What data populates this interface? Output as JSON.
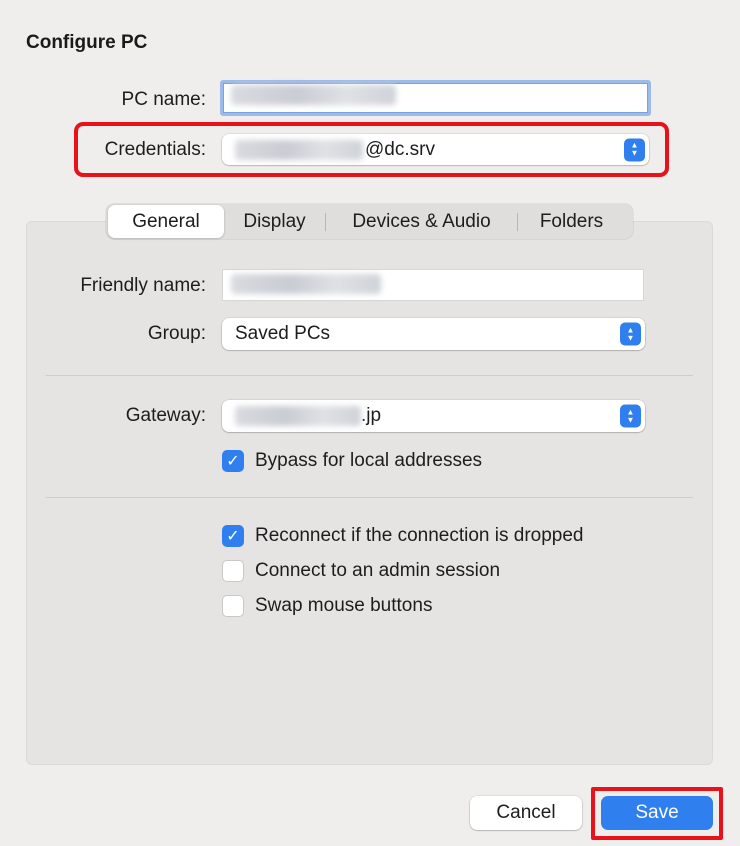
{
  "dialog": {
    "title": "Configure PC"
  },
  "pc_name": {
    "label": "PC name:",
    "value": ""
  },
  "credentials": {
    "label": "Credentials:",
    "value_suffix": "@dc.srv"
  },
  "tabs": [
    {
      "label": "General",
      "active": true
    },
    {
      "label": "Display",
      "active": false
    },
    {
      "label": "Devices & Audio",
      "active": false
    },
    {
      "label": "Folders",
      "active": false
    }
  ],
  "friendly_name": {
    "label": "Friendly name:",
    "value": ""
  },
  "group": {
    "label": "Group:",
    "value": "Saved PCs"
  },
  "gateway": {
    "label": "Gateway:",
    "value_suffix": ".jp"
  },
  "options": {
    "bypass_local": {
      "label": "Bypass for local addresses",
      "checked": true
    },
    "reconnect": {
      "label": "Reconnect if the connection is dropped",
      "checked": true
    },
    "admin_session": {
      "label": "Connect to an admin session",
      "checked": false
    },
    "swap_mouse": {
      "label": "Swap mouse buttons",
      "checked": false
    }
  },
  "buttons": {
    "cancel": "Cancel",
    "save": "Save"
  },
  "colors": {
    "accent": "#2f80ee",
    "highlight": "#e8131a"
  },
  "icons": {
    "popup_arrows": "up-down-chevron-icon",
    "checkmark": "checkmark-icon"
  }
}
